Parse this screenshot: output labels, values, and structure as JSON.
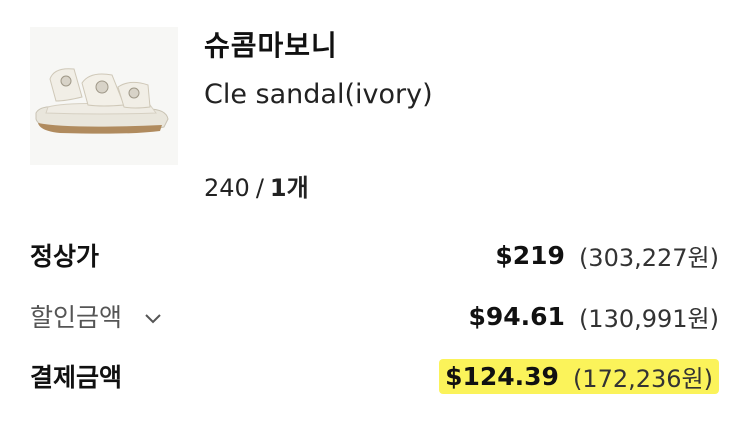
{
  "product": {
    "brand": "슈콤마보니",
    "name": "Cle sandal(ivory)",
    "size": "240",
    "separator": "/",
    "quantity": "1개",
    "image_alt": "ivory platform sandal"
  },
  "summary": {
    "regular": {
      "label": "정상가",
      "usd": "$219",
      "krw": "(303,227원)"
    },
    "discount": {
      "label": "할인금액",
      "usd": "$94.61",
      "krw": "(130,991원)",
      "icon": "chevron-down-icon"
    },
    "payment": {
      "label": "결제금액",
      "usd": "$124.39",
      "krw": "(172,236원)",
      "highlight_color": "#fbf35a"
    }
  }
}
